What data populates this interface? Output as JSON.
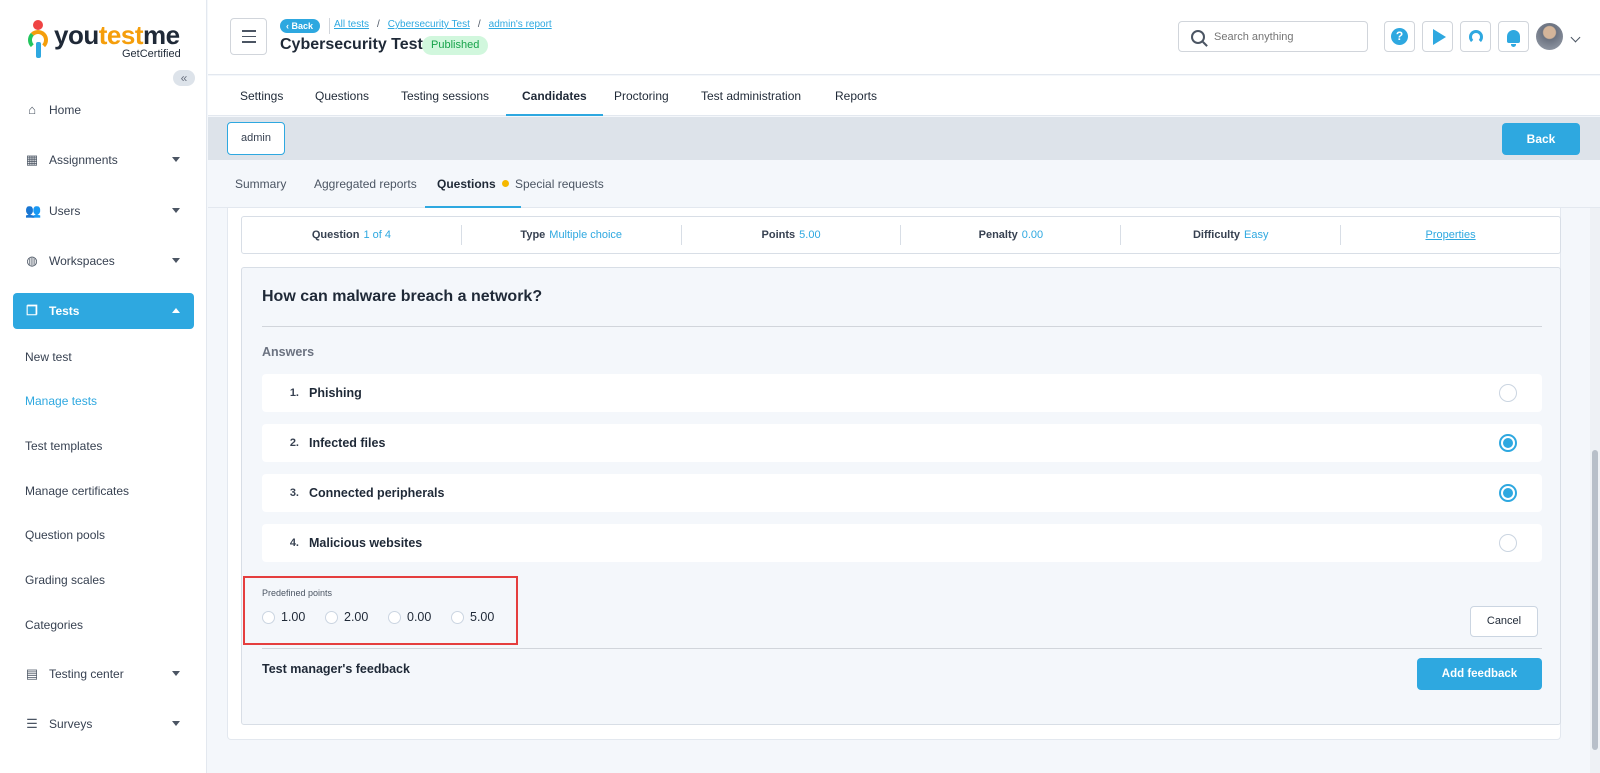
{
  "brand": {
    "name_prefix": "you",
    "name_accent": "test",
    "name_suffix": "me",
    "tagline": "GetCertified"
  },
  "sidebar": {
    "items": [
      {
        "label": "Home",
        "icon": "home-icon"
      },
      {
        "label": "Assignments",
        "icon": "assignments-icon"
      },
      {
        "label": "Users",
        "icon": "users-icon"
      },
      {
        "label": "Workspaces",
        "icon": "globe-icon"
      },
      {
        "label": "Tests",
        "icon": "tests-icon"
      },
      {
        "label": "Testing center",
        "icon": "testing-center-icon"
      },
      {
        "label": "Surveys",
        "icon": "surveys-icon"
      }
    ],
    "subitems": [
      "New test",
      "Manage tests",
      "Test templates",
      "Manage certificates",
      "Question pools",
      "Grading scales",
      "Categories"
    ]
  },
  "header": {
    "back_label": "Back",
    "breadcrumbs": [
      "All tests",
      "Cybersecurity Test",
      "admin's report"
    ],
    "title": "Cybersecurity Test",
    "status": "Published",
    "search_placeholder": "Search anything"
  },
  "main_tabs": [
    "Settings",
    "Questions",
    "Testing sessions",
    "Candidates",
    "Proctoring",
    "Test administration",
    "Reports"
  ],
  "user_chip": "admin",
  "back_button": "Back",
  "sub_tabs": [
    "Summary",
    "Aggregated reports",
    "Questions",
    "Special requests"
  ],
  "question_meta": {
    "question_label": "Question",
    "question_value": "1 of 4",
    "type_label": "Type",
    "type_value": "Multiple choice",
    "points_label": "Points",
    "points_value": "5.00",
    "penalty_label": "Penalty",
    "penalty_value": "0.00",
    "difficulty_label": "Difficulty",
    "difficulty_value": "Easy",
    "properties_link": "Properties"
  },
  "question": {
    "text": "How can malware breach a network?",
    "answers_label": "Answers",
    "answers": [
      {
        "num": "1.",
        "text": "Phishing",
        "selected": false
      },
      {
        "num": "2.",
        "text": "Infected files",
        "selected": true
      },
      {
        "num": "3.",
        "text": "Connected peripherals",
        "selected": true
      },
      {
        "num": "4.",
        "text": "Malicious websites",
        "selected": false
      }
    ]
  },
  "predefined_points": {
    "label": "Predefined points",
    "options": [
      "1.00",
      "2.00",
      "0.00",
      "5.00"
    ]
  },
  "cancel_button": "Cancel",
  "feedback": {
    "label": "Test manager's feedback",
    "button": "Add feedback"
  },
  "colors": {
    "accent": "#2ea8e0",
    "status_green": "#16a34a",
    "highlight_red": "#e53e3e",
    "badge_dot": "#f5b800"
  }
}
